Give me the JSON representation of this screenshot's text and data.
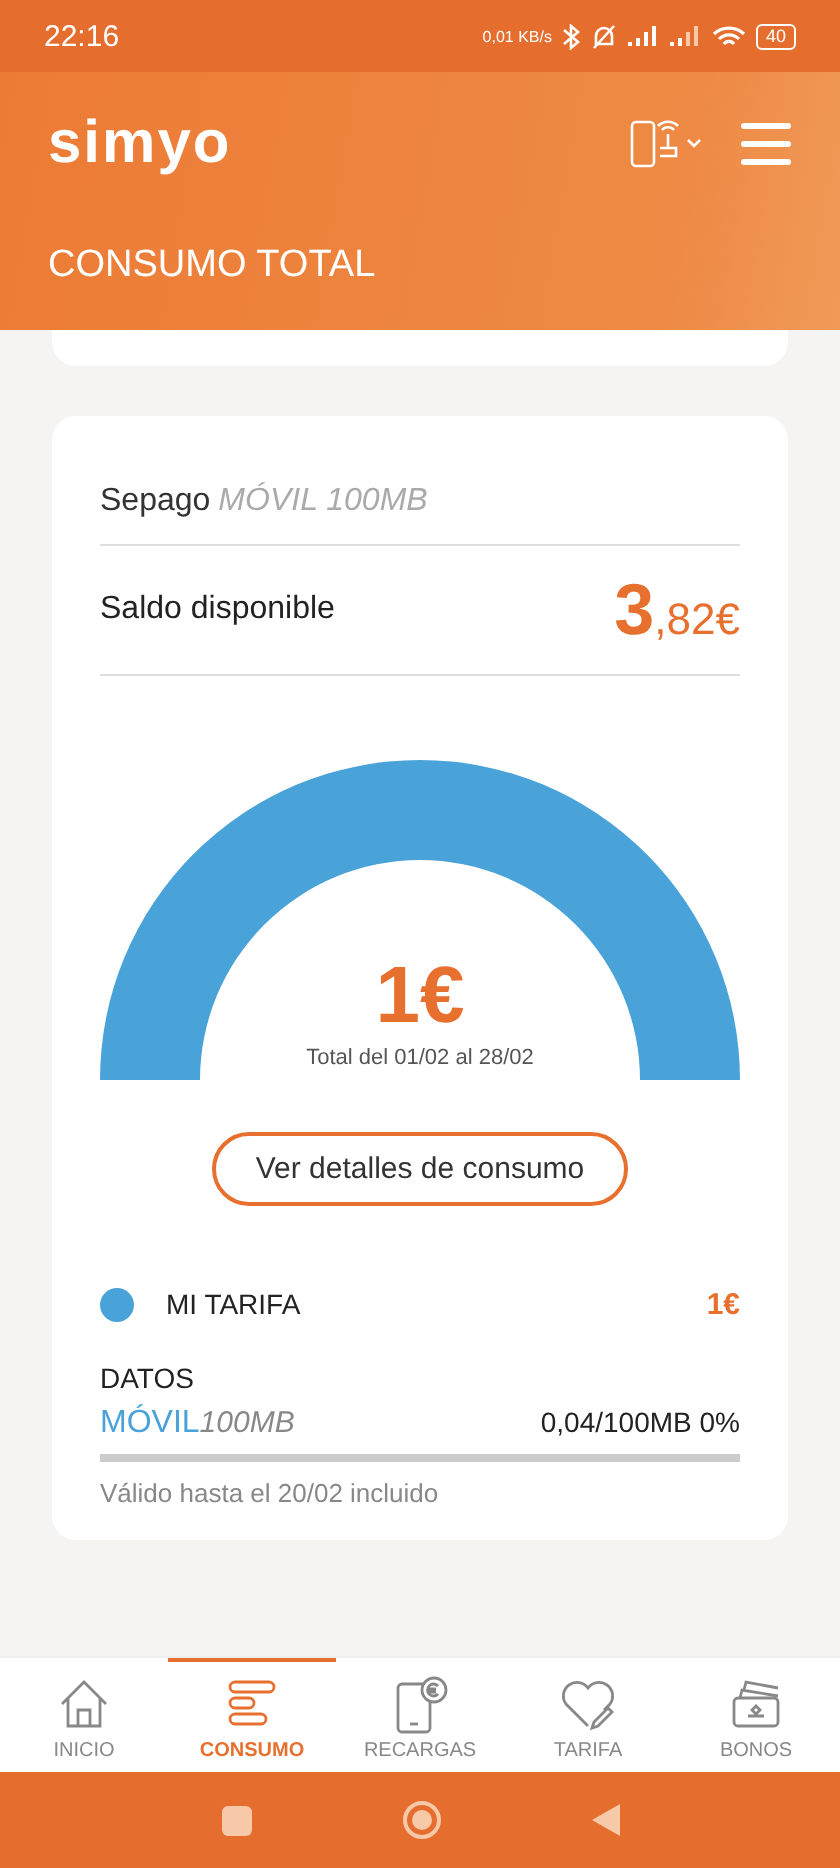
{
  "status_bar": {
    "time": "22:16",
    "net_speed": "0,01 KB/s",
    "battery": "40"
  },
  "header": {
    "logo": "simyo",
    "title": "CONSUMO TOTAL"
  },
  "card": {
    "ghost_row": {
      "label": "Sepago",
      "detail": "MÓVIL 100MB"
    },
    "balance": {
      "label": "Saldo disponible",
      "whole": "3",
      "fraction": ",82€"
    },
    "gauge": {
      "amount": "1€",
      "period": "Total del 01/02 al 28/02"
    },
    "details_button": "Ver detalles de consumo",
    "tariff": {
      "name": "MI TARIFA",
      "amount": "1€",
      "color": "#4aa3d8"
    },
    "data": {
      "heading": "DATOS",
      "type": "MÓVIL",
      "plan": "100MB",
      "usage": "0,04/100MB 0%",
      "level": 0,
      "validity": "Válido hasta el 20/02 incluido"
    }
  },
  "bottom_nav": [
    {
      "kind": "home",
      "label": "INICIO",
      "selected": false
    },
    {
      "kind": "bars",
      "label": "CONSUMO",
      "selected": true
    },
    {
      "kind": "topup",
      "label": "RECARGAS",
      "selected": false
    },
    {
      "kind": "heart",
      "label": "TARIFA",
      "selected": false
    },
    {
      "kind": "wallet",
      "label": "BONOS",
      "selected": false
    }
  ]
}
